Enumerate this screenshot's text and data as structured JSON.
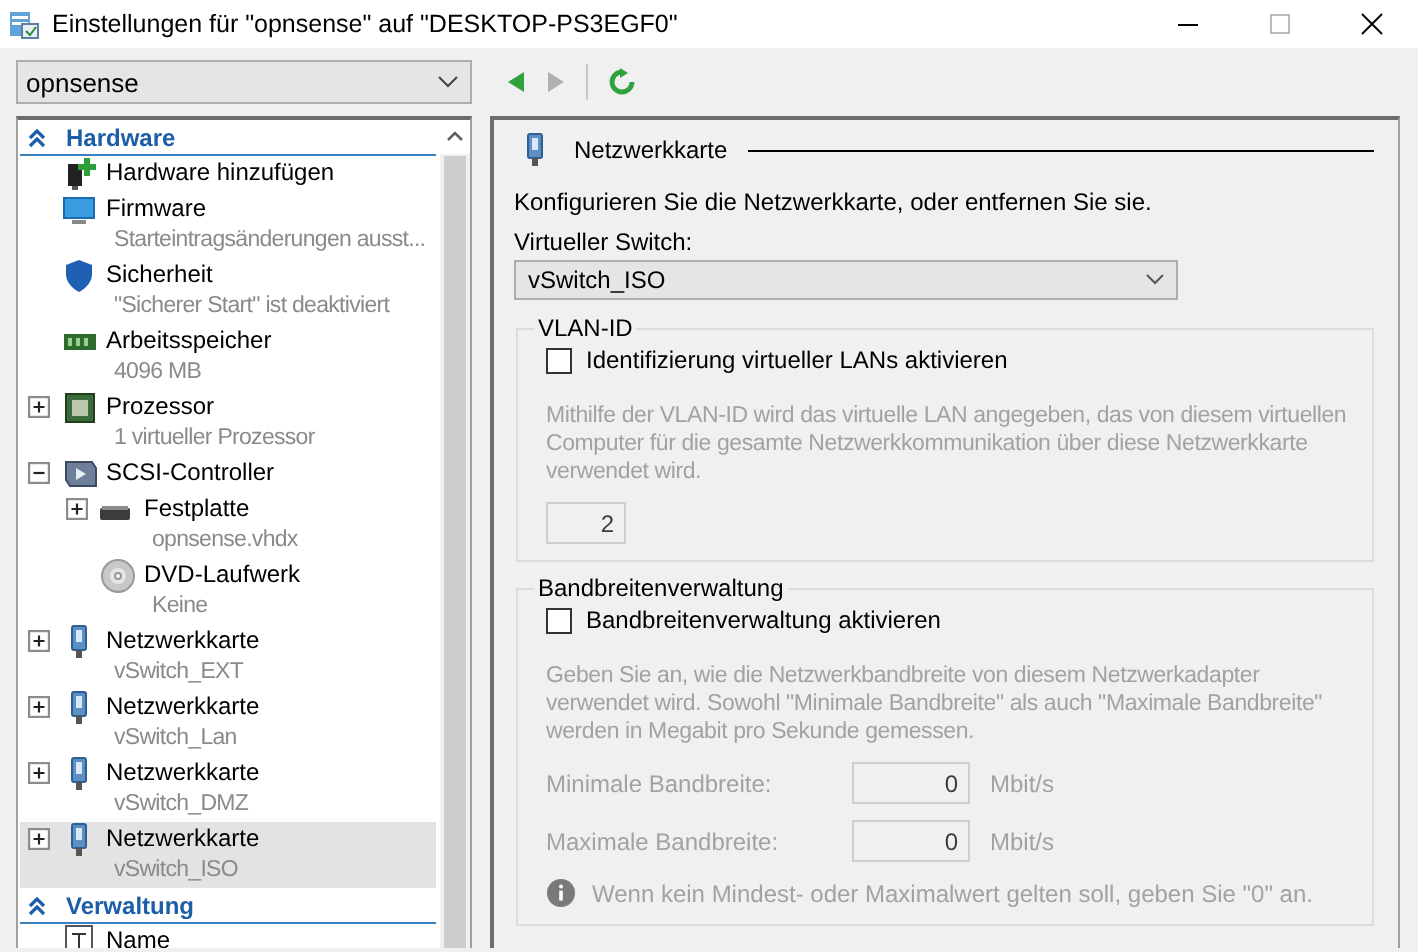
{
  "window": {
    "title": "Einstellungen für \"opnsense\" auf \"DESKTOP-PS3EGF0\""
  },
  "toolbar": {
    "vm_select": {
      "value": "opnsense"
    },
    "back": {
      "disabled": false
    },
    "forward": {
      "disabled": true
    }
  },
  "sidebar": {
    "sections": [
      {
        "title": "Hardware",
        "expanded": true,
        "items": [
          {
            "kind": "add-hardware",
            "label": "Hardware hinzufügen",
            "selected": false
          },
          {
            "kind": "firmware",
            "label": "Firmware",
            "detail": "Starteintragsänderungen ausst...",
            "selected": false
          },
          {
            "kind": "security",
            "label": "Sicherheit",
            "detail": "\"Sicherer Start\" ist deaktiviert",
            "selected": false
          },
          {
            "kind": "memory",
            "label": "Arbeitsspeicher",
            "detail": "4096 MB",
            "selected": false
          },
          {
            "kind": "processor",
            "label": "Prozessor",
            "detail": "1 virtueller Prozessor",
            "expanded": false,
            "selected": false
          },
          {
            "kind": "controller",
            "label": "SCSI-Controller",
            "expanded": true,
            "selected": false,
            "children": [
              {
                "kind": "disk",
                "label": "Festplatte",
                "detail": "opnsense.vhdx",
                "expanded": false,
                "selected": false
              },
              {
                "kind": "dvd",
                "label": "DVD-Laufwerk",
                "detail": "Keine",
                "selected": false
              }
            ]
          },
          {
            "kind": "network",
            "label": "Netzwerkkarte",
            "detail": "vSwitch_EXT",
            "expanded": false,
            "selected": false
          },
          {
            "kind": "network",
            "label": "Netzwerkkarte",
            "detail": "vSwitch_Lan",
            "expanded": false,
            "selected": false
          },
          {
            "kind": "network",
            "label": "Netzwerkkarte",
            "detail": "vSwitch_DMZ",
            "expanded": false,
            "selected": false
          },
          {
            "kind": "network",
            "label": "Netzwerkkarte",
            "detail": "vSwitch_ISO",
            "expanded": false,
            "selected": true
          }
        ]
      },
      {
        "title": "Verwaltung",
        "expanded": true,
        "items": [
          {
            "kind": "name",
            "label": "Name",
            "selected": false
          }
        ]
      }
    ]
  },
  "panel": {
    "title": "Netzwerkkarte",
    "description": "Konfigurieren Sie die Netzwerkkarte, oder entfernen Sie sie.",
    "switch_label": "Virtueller Switch:",
    "switch_select": {
      "value": "vSwitch_ISO"
    },
    "vlan": {
      "legend": "VLAN-ID",
      "checkbox": {
        "label": "Identifizierung virtueller LANs aktivieren",
        "checked": false
      },
      "help": "Mithilfe der VLAN-ID wird das virtuelle LAN angegeben, das von diesem virtuellen Computer für die gesamte Netzwerkkommunikation über diese Netzwerkkarte verwendet wird.",
      "vlan_id": {
        "value": "2"
      }
    },
    "bandwidth": {
      "legend": "Bandbreitenverwaltung",
      "checkbox": {
        "label": "Bandbreitenverwaltung aktivieren",
        "checked": false
      },
      "help": "Geben Sie an, wie die Netzwerkbandbreite von diesem Netzwerkadapter verwendet wird. Sowohl \"Minimale Bandbreite\" als auch \"Maximale Bandbreite\" werden in Megabit pro Sekunde gemessen.",
      "fields": [
        {
          "label": "Minimale Bandbreite:",
          "value": "0",
          "unit": "Mbit/s"
        },
        {
          "label": "Maximale Bandbreite:",
          "value": "0",
          "unit": "Mbit/s"
        }
      ],
      "note": "Wenn kein Mindest- oder Maximalwert gelten soll, geben Sie \"0\" an."
    }
  }
}
